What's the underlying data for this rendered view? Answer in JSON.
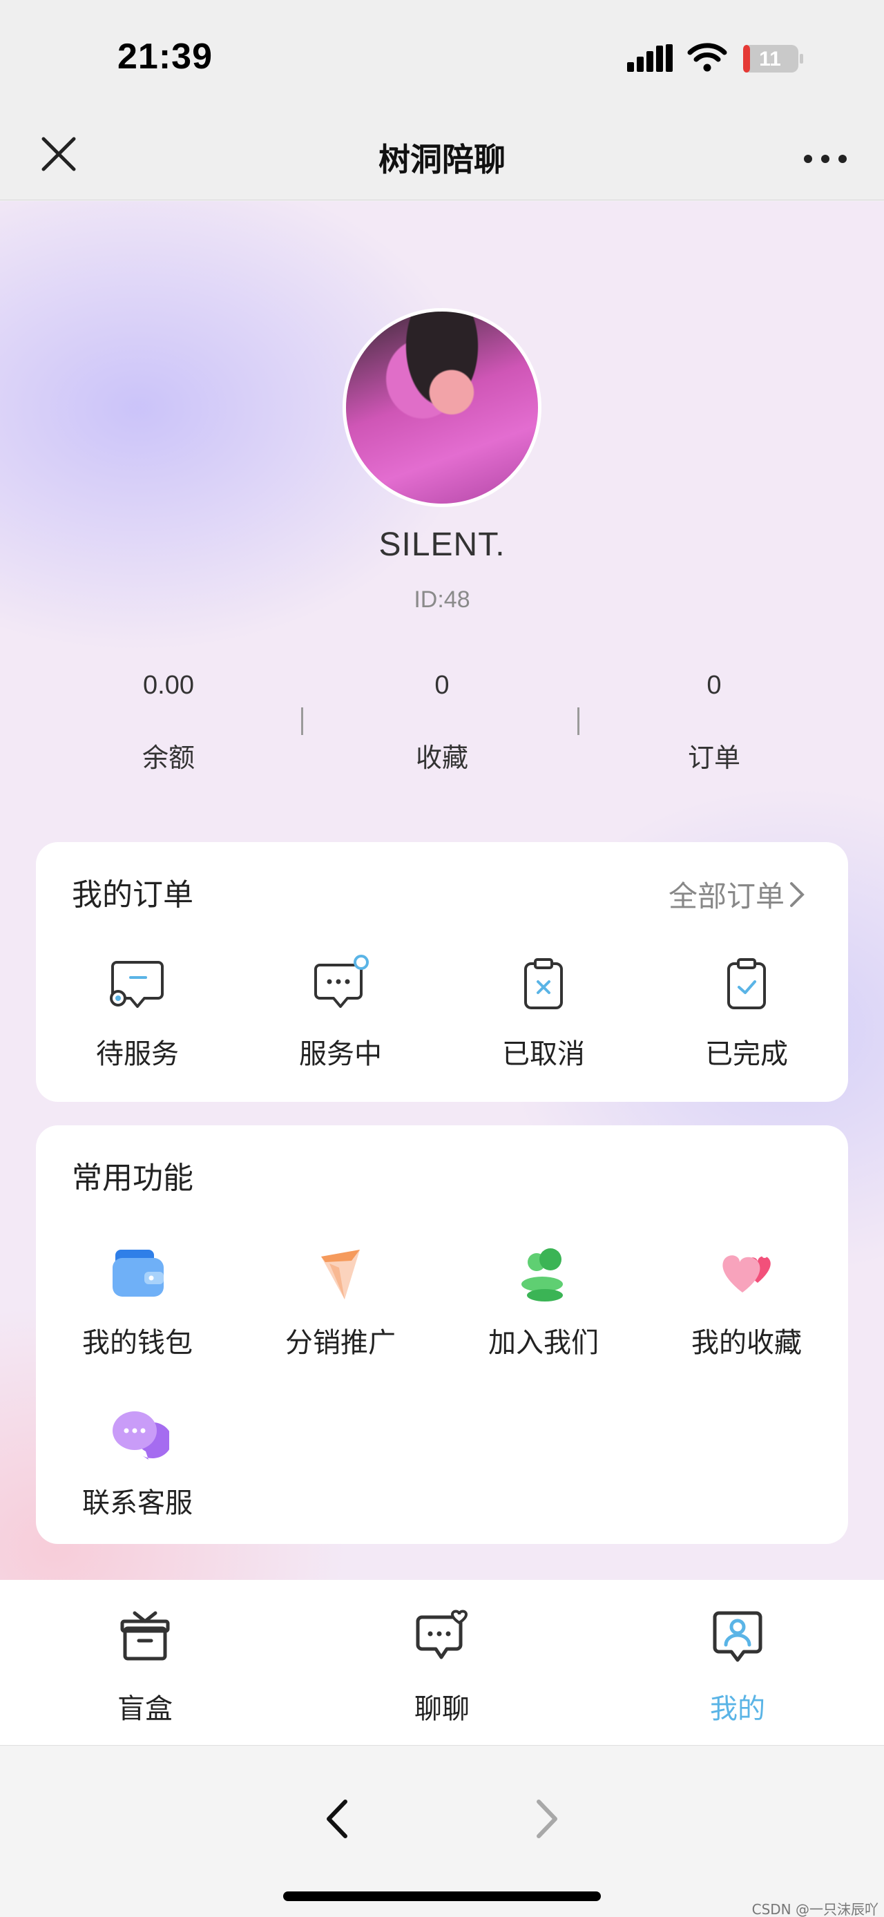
{
  "status_bar": {
    "time": "21:39",
    "battery_level": "11"
  },
  "navbar": {
    "title": "树洞陪聊"
  },
  "profile": {
    "name": "SILENT.",
    "id_text": "ID:48",
    "stats": [
      {
        "value": "0.00",
        "label": "余额"
      },
      {
        "value": "0",
        "label": "收藏"
      },
      {
        "value": "0",
        "label": "订单"
      }
    ]
  },
  "orders": {
    "title": "我的订单",
    "all_link": "全部订单",
    "items": [
      {
        "label": "待服务",
        "icon": "pending-service-icon"
      },
      {
        "label": "服务中",
        "icon": "in-service-icon"
      },
      {
        "label": "已取消",
        "icon": "cancelled-icon"
      },
      {
        "label": "已完成",
        "icon": "completed-icon"
      }
    ]
  },
  "functions": {
    "title": "常用功能",
    "items": [
      {
        "label": "我的钱包",
        "icon": "wallet-icon"
      },
      {
        "label": "分销推广",
        "icon": "promotion-icon"
      },
      {
        "label": "加入我们",
        "icon": "join-us-icon"
      },
      {
        "label": "我的收藏",
        "icon": "favorites-heart-icon"
      },
      {
        "label": "联系客服",
        "icon": "customer-service-icon"
      }
    ]
  },
  "tabbar": {
    "items": [
      {
        "label": "盲盒",
        "icon": "gift-box-icon",
        "active": false
      },
      {
        "label": "聊聊",
        "icon": "chat-heart-icon",
        "active": false
      },
      {
        "label": "我的",
        "icon": "profile-icon",
        "active": true
      }
    ]
  },
  "colors": {
    "accent": "#5ab4e6",
    "background": "#f3e9f6",
    "card": "#ffffff"
  },
  "watermark": "CSDN @一只沫辰吖"
}
